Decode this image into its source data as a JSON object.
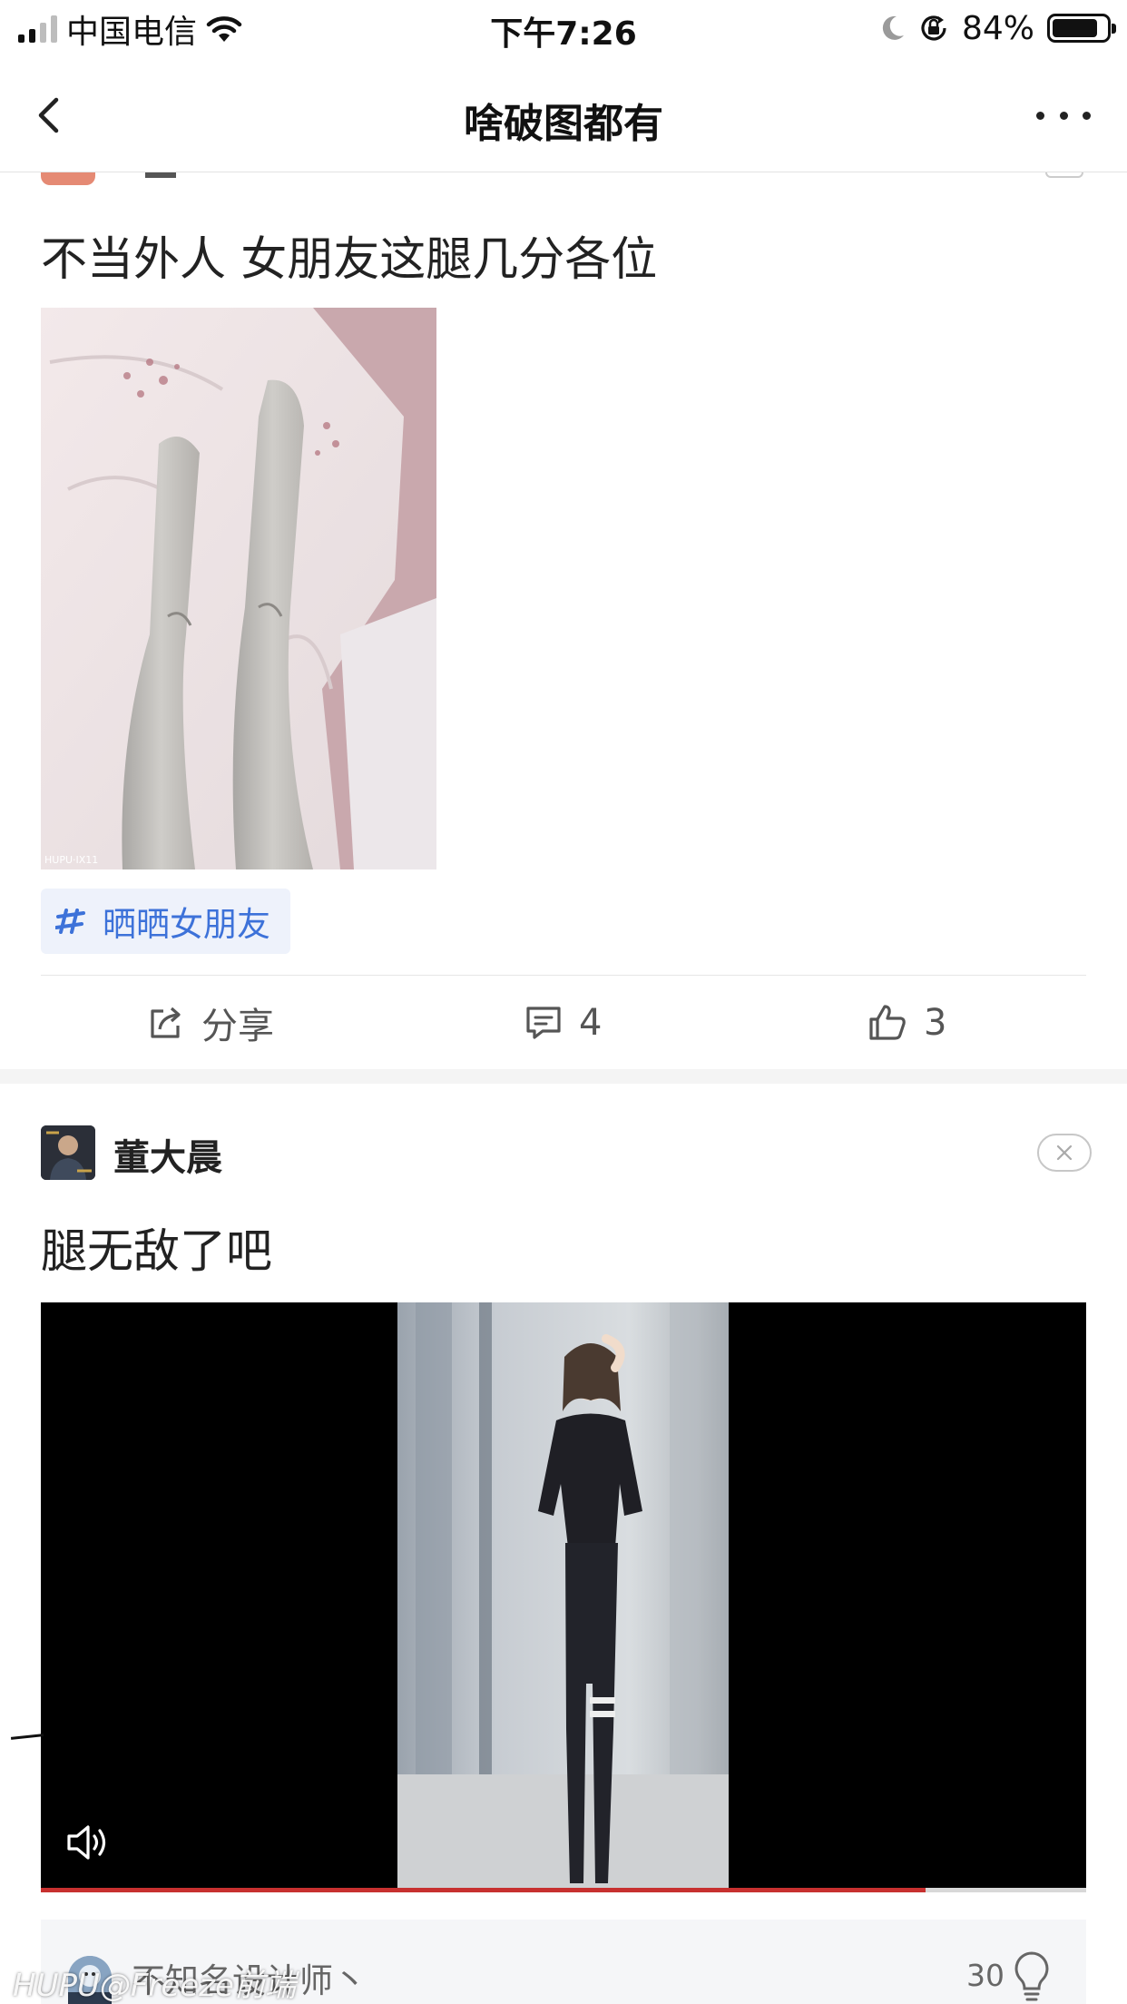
{
  "status_bar": {
    "carrier": "中国电信",
    "time": "下午7:26",
    "battery": "84%",
    "battery_level": 0.84
  },
  "nav": {
    "title": "啥破图都有"
  },
  "post1": {
    "title": "不当外人  女朋友这腿几分各位",
    "topic": "晒晒女朋友",
    "share_label": "分享",
    "comment_count": "4",
    "like_count": "3"
  },
  "post2": {
    "author": "董大晨",
    "title": "腿无敌了吧",
    "video_progress": 0.846
  },
  "comment_preview": {
    "author": "不知名设计师丶",
    "light_count": "30"
  },
  "watermark": "HUPU@Freeze前端",
  "icons": [
    "back-chevron-icon",
    "more-icon",
    "moon-icon",
    "rotation-lock-icon",
    "wifi-icon",
    "hashtag-icon",
    "share-icon",
    "comment-icon",
    "thumbs-up-icon",
    "close-icon",
    "volume-icon",
    "lightbulb-icon"
  ],
  "colors": {
    "topic_text": "#3d72d9",
    "topic_bg": "#eef2fb",
    "progress": "#c7302f"
  }
}
